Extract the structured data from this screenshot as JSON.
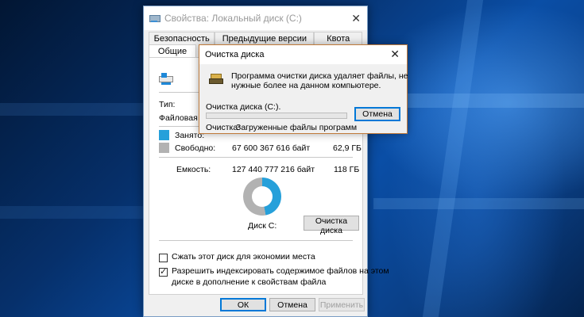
{
  "properties": {
    "title": "Свойства: Локальный диск (C:)",
    "tabs_row1": [
      "Безопасность",
      "Предыдущие версии",
      "Квота"
    ],
    "tabs_row2": [
      "Общие"
    ],
    "type_label": "Тип:",
    "fs_label": "Файловая си",
    "used_label": "Занято:",
    "free_label": "Свободно:",
    "free_bytes": "67 600 367 616 байт",
    "free_gb": "62,9 ГБ",
    "capacity_label": "Емкость:",
    "capacity_bytes": "127 440 777 216 байт",
    "capacity_gb": "118 ГБ",
    "drive_label": "Диск C:",
    "cleanup_button": "Очистка диска",
    "compress_label": "Сжать этот диск для экономии места",
    "compress_checked": false,
    "index_label_1": "Разрешить индексировать содержимое файлов на этом",
    "index_label_2": "диске в дополнение к свойствам файла",
    "index_checked": true,
    "ok_button": "ОК",
    "cancel_button": "Отмена",
    "apply_button": "Применить",
    "used_color": "#26a0da",
    "free_color": "#b2b2b2",
    "used_fraction": 0.47
  },
  "cleanup_dialog": {
    "title": "Очистка диска",
    "message_1": "Программа очистки диска удаляет файлы, не",
    "message_2": "нужные более на данном компьютере.",
    "status": "Очистка диска  (C:).",
    "cancel_button": "Отмена",
    "cleaning_label": "Очистка:",
    "cleaning_item": "Загруженные файлы программ",
    "progress": 0.0
  }
}
